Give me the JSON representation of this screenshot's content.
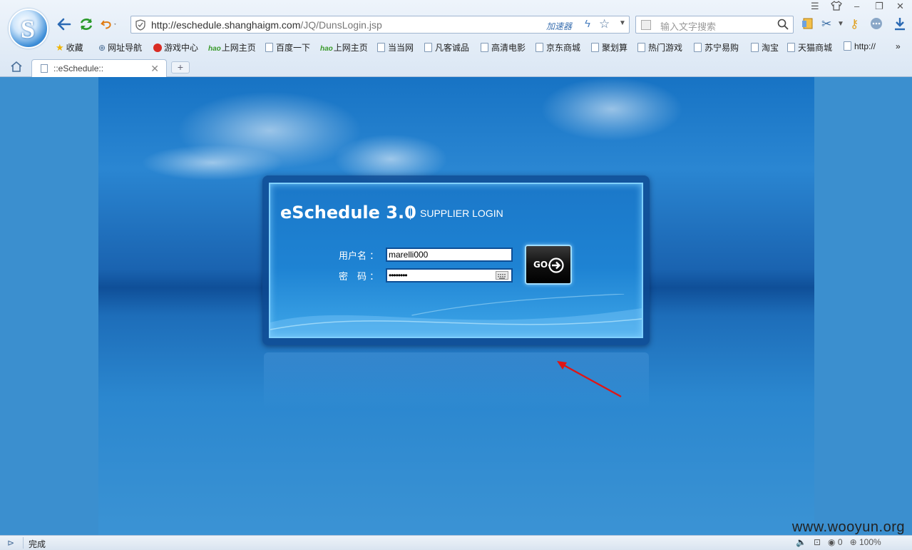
{
  "browser": {
    "url_prefix": "http://eschedule.shanghaigm.com",
    "url_path": "/JQ/DunsLogin.jsp",
    "accelerator_label": "加速器",
    "search_placeholder": "输入文字搜索",
    "tab_title": "::eSchedule::",
    "new_tab": "+",
    "bookmarks": [
      {
        "label": "收藏",
        "icon": "star-icon"
      },
      {
        "label": "网址导航",
        "icon": "globe-icon"
      },
      {
        "label": "游戏中心",
        "icon": "game-icon"
      },
      {
        "label": "上网主页",
        "icon": "hao-icon",
        "prefix": "hao"
      },
      {
        "label": "百度一下",
        "icon": "page-icon"
      },
      {
        "label": "上网主页",
        "icon": "hao-icon",
        "prefix": "hao"
      },
      {
        "label": "当当网",
        "icon": "page-icon"
      },
      {
        "label": "凡客诚品",
        "icon": "page-icon"
      },
      {
        "label": "高清电影",
        "icon": "page-icon"
      },
      {
        "label": "京东商城",
        "icon": "page-icon"
      },
      {
        "label": "聚划算",
        "icon": "page-icon"
      },
      {
        "label": "热门游戏",
        "icon": "page-icon"
      },
      {
        "label": "苏宁易购",
        "icon": "page-icon"
      },
      {
        "label": "淘宝",
        "icon": "page-icon"
      },
      {
        "label": "天猫商城",
        "icon": "page-icon"
      },
      {
        "label": "http://",
        "icon": "page-icon"
      }
    ],
    "more_bookmarks": "»"
  },
  "login": {
    "app_title": "eSchedule 3.0",
    "subtitle": "SUPPLIER LOGIN",
    "username_label": "用户名 ：",
    "password_label": "密　码 ：",
    "username_value": "marelli000",
    "password_value": "••••••••",
    "go_label": "GO"
  },
  "status": {
    "text": "完成",
    "zero": "0",
    "zoom": "100%"
  },
  "watermark": "www.wooyun.org",
  "colors": {
    "accent": "#1b78c9",
    "annotation_arrow": "#e01515"
  }
}
